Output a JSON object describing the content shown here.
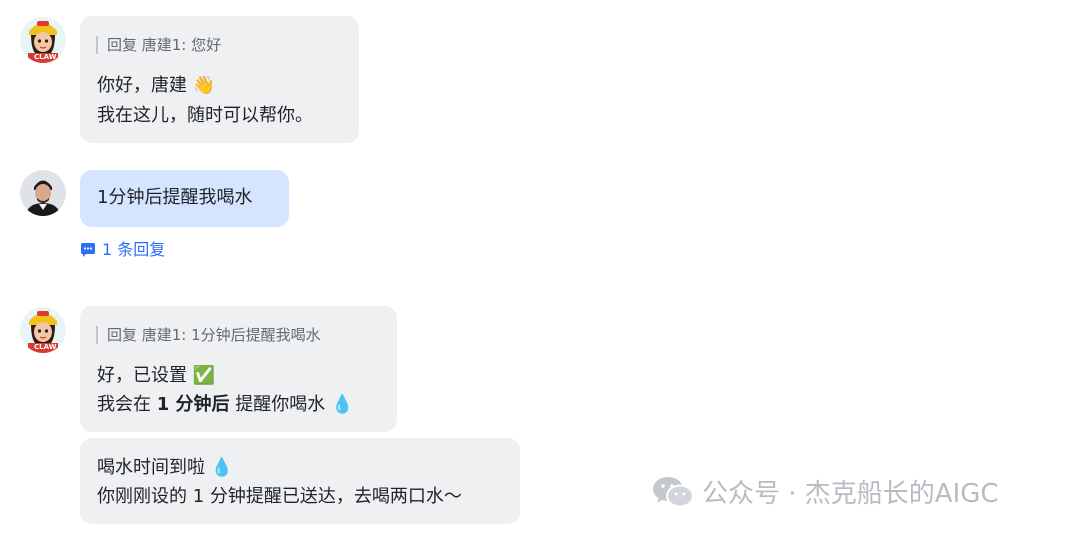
{
  "messages": [
    {
      "quote": "回复 唐建1: 您好",
      "line1": "你好，唐建",
      "line1_emoji": "👋",
      "line2": "我在这儿，随时可以帮你。"
    },
    {
      "text": "1分钟后提醒我喝水"
    },
    {
      "quote": "回复 唐建1: 1分钟后提醒我喝水",
      "line1": "好，已设置",
      "line1_emoji": "✅",
      "line2_pre": "我会在",
      "line2_bold": "1 分钟后",
      "line2_post": "提醒你喝水",
      "line2_emoji": "💧"
    },
    {
      "line1": "喝水时间到啦",
      "line1_emoji": "💧",
      "line2": "你刚刚设的 1 分钟提醒已送达，去喝两口水～"
    }
  ],
  "thread": {
    "reply_count_label": "1 条回复"
  },
  "bot_avatar": {
    "badge": "CLAW"
  },
  "watermark": {
    "text": "公众号 · 杰克船长的AIGC"
  },
  "colors": {
    "user_bubble": "#d6e5ff",
    "bot_bubble": "#eff0f1",
    "link": "#2f6df6"
  }
}
